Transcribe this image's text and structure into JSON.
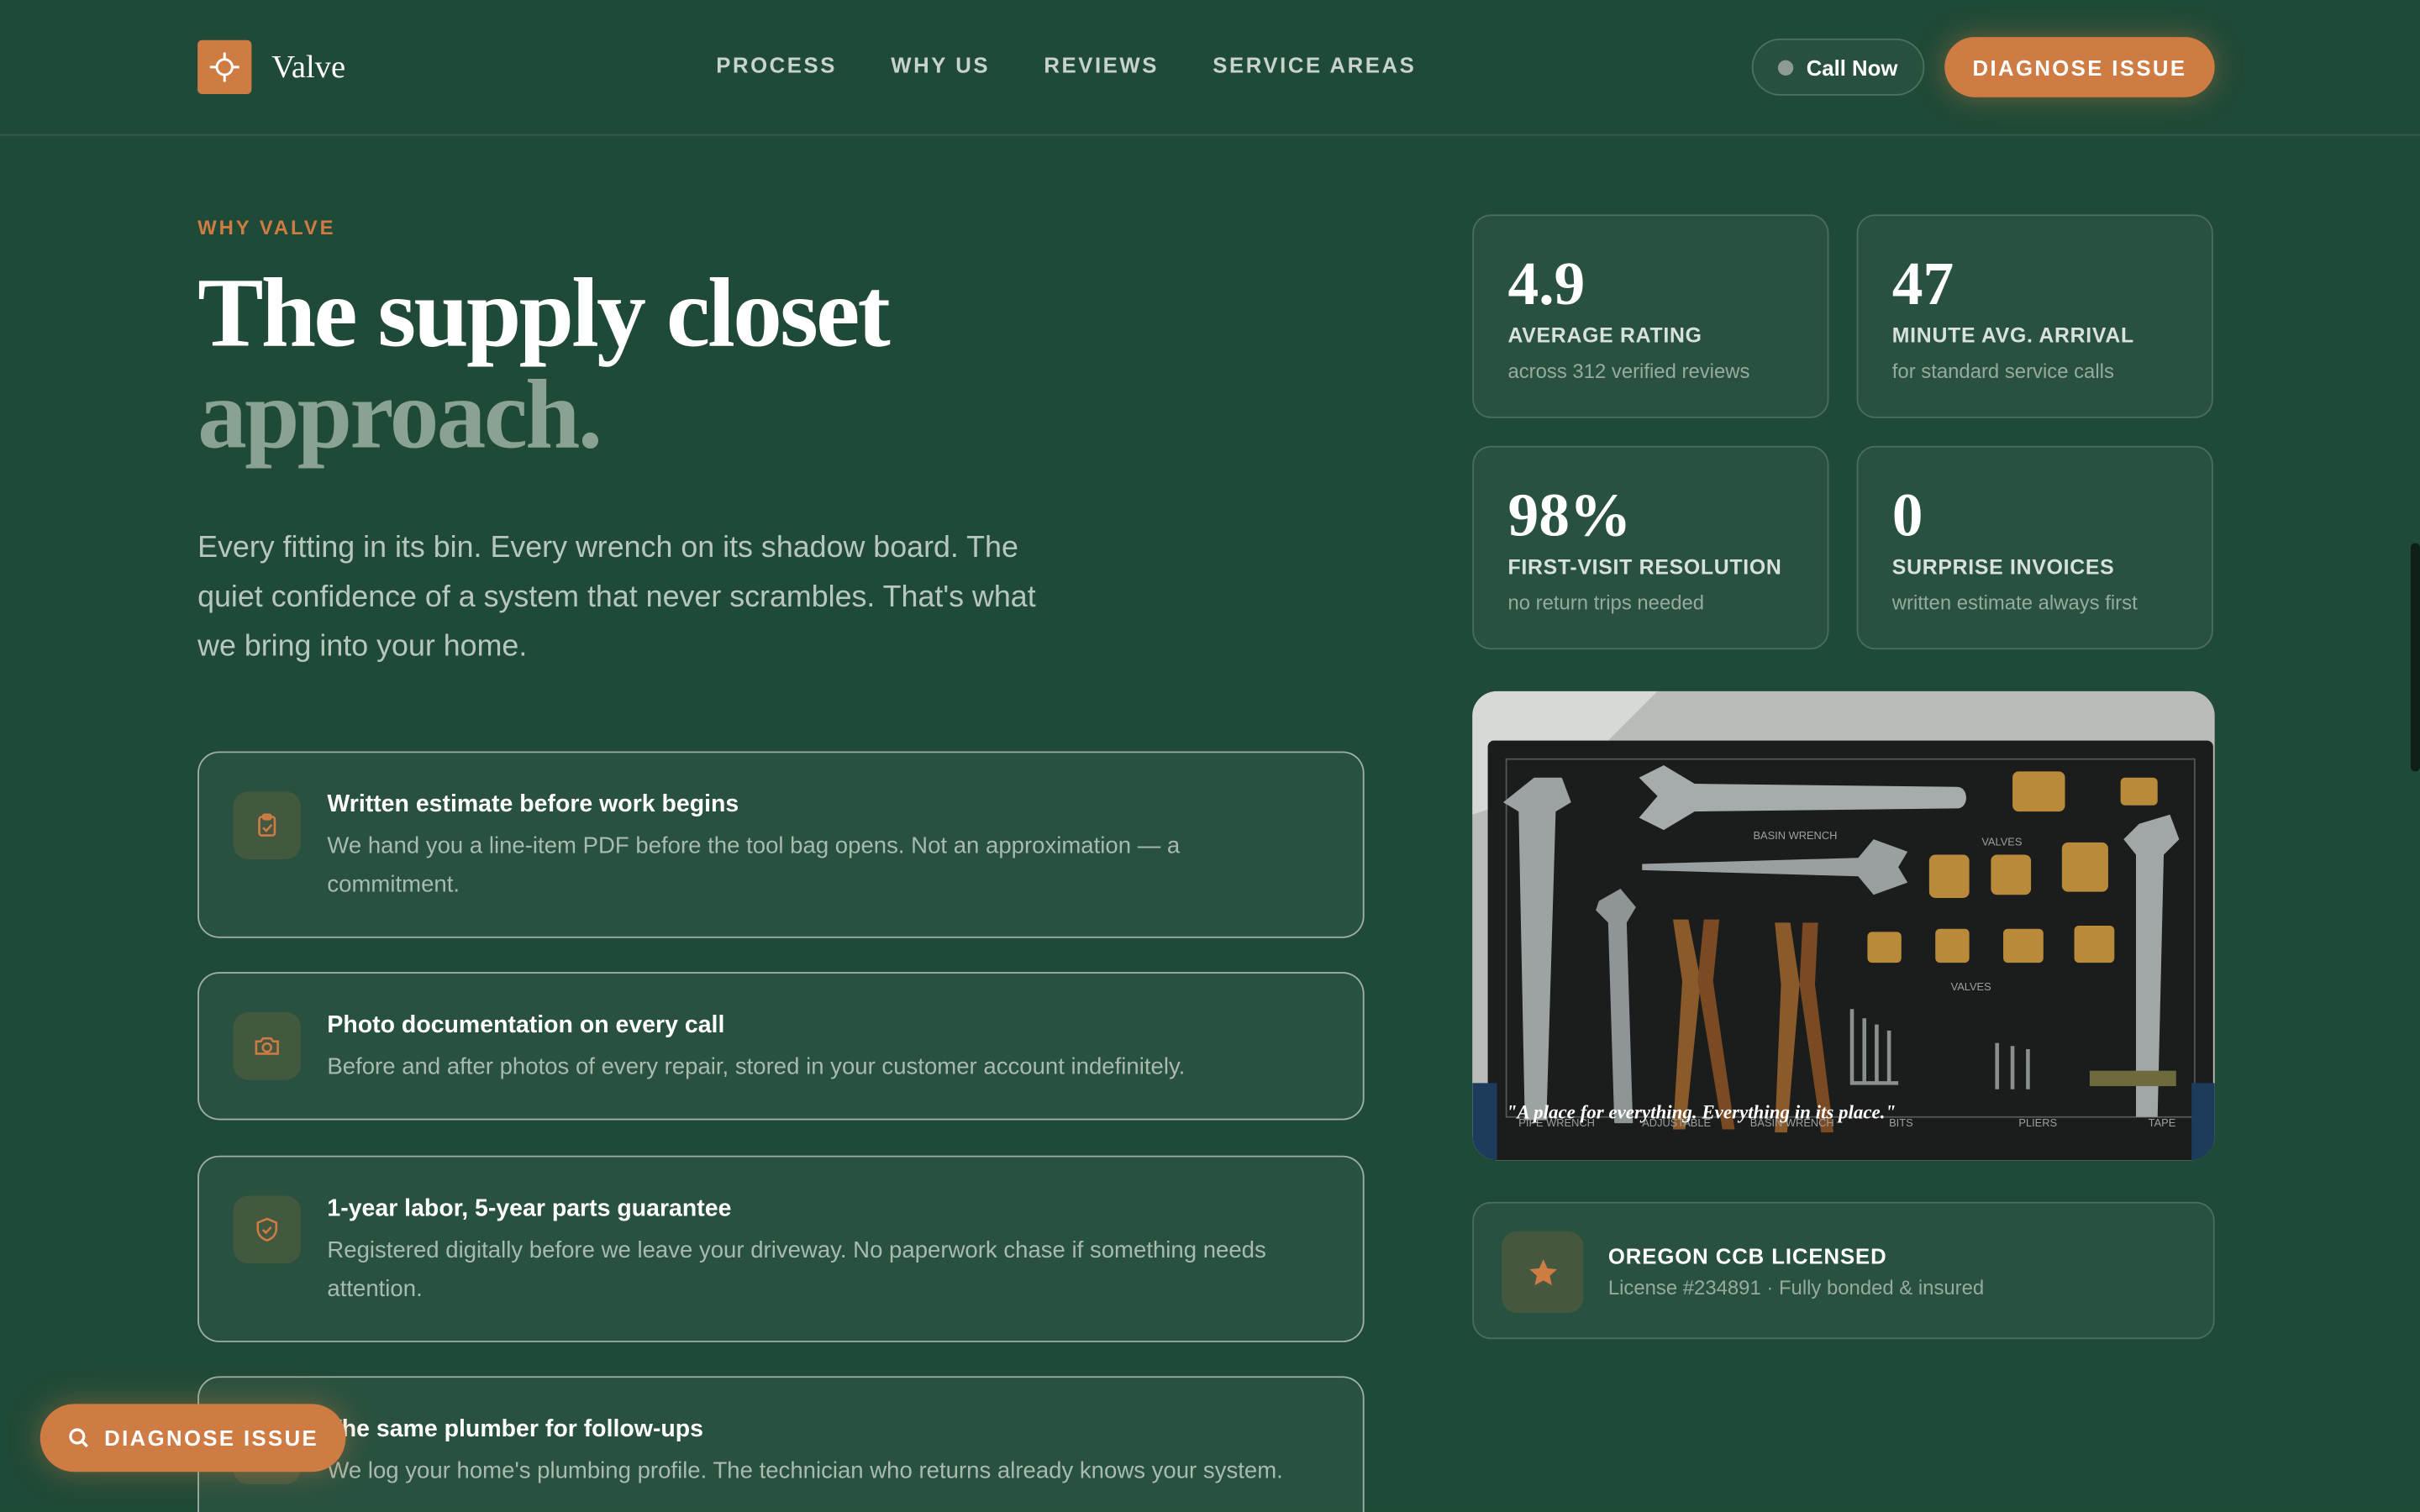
{
  "header": {
    "brand": "Valve",
    "nav": [
      "PROCESS",
      "WHY US",
      "REVIEWS",
      "SERVICE AREAS"
    ],
    "call_label": "Call Now",
    "cta_label": "DIAGNOSE ISSUE"
  },
  "hero": {
    "eyebrow": "WHY VALVE",
    "title_line1": "The supply closet",
    "title_line2": "approach.",
    "lead": "Every fitting in its bin. Every wrench on its shadow board. The quiet confidence of a system that never scrambles. That's what we bring into your home."
  },
  "features": [
    {
      "icon": "clipboard-icon",
      "title": "Written estimate before work begins",
      "desc": "We hand you a line-item PDF before the tool bag opens. Not an approximation — a commitment."
    },
    {
      "icon": "camera-icon",
      "title": "Photo documentation on every call",
      "desc": "Before and after photos of every repair, stored in your customer account indefinitely."
    },
    {
      "icon": "shield-check-icon",
      "title": "1-year labor, 5-year parts guarantee",
      "desc": "Registered digitally before we leave your driveway. No paperwork chase if something needs attention."
    },
    {
      "icon": "user-icon",
      "title": "The same plumber for follow-ups",
      "desc": "We log your home's plumbing profile. The technician who returns already knows your system."
    }
  ],
  "stats": [
    {
      "value": "4.9",
      "label": "AVERAGE RATING",
      "sub": "across 312 verified reviews"
    },
    {
      "value": "47",
      "label": "MINUTE AVG. ARRIVAL",
      "sub": "for standard service calls"
    },
    {
      "value": "98%",
      "label": "FIRST-VISIT RESOLUTION",
      "sub": "no return trips needed"
    },
    {
      "value": "0",
      "label": "SURPRISE INVOICES",
      "sub": "written estimate always first"
    }
  ],
  "board": {
    "quote": "\"A place for everything. Everything in its place.\"",
    "labels": [
      "BASIN WRENCH",
      "VALVES",
      "VALVES",
      "PIPE WRENCH",
      "ADJUSTABLE",
      "BASIN WRENCH",
      "BITS",
      "PLIERS",
      "TAPE"
    ]
  },
  "license": {
    "title": "OREGON CCB LICENSED",
    "sub": "License #234891 · Fully bonded & insured"
  },
  "floating_cta": "DIAGNOSE ISSUE",
  "colors": {
    "background": "#1f4a37",
    "accent": "#cf7c44",
    "muted_title": "#8aa294"
  }
}
